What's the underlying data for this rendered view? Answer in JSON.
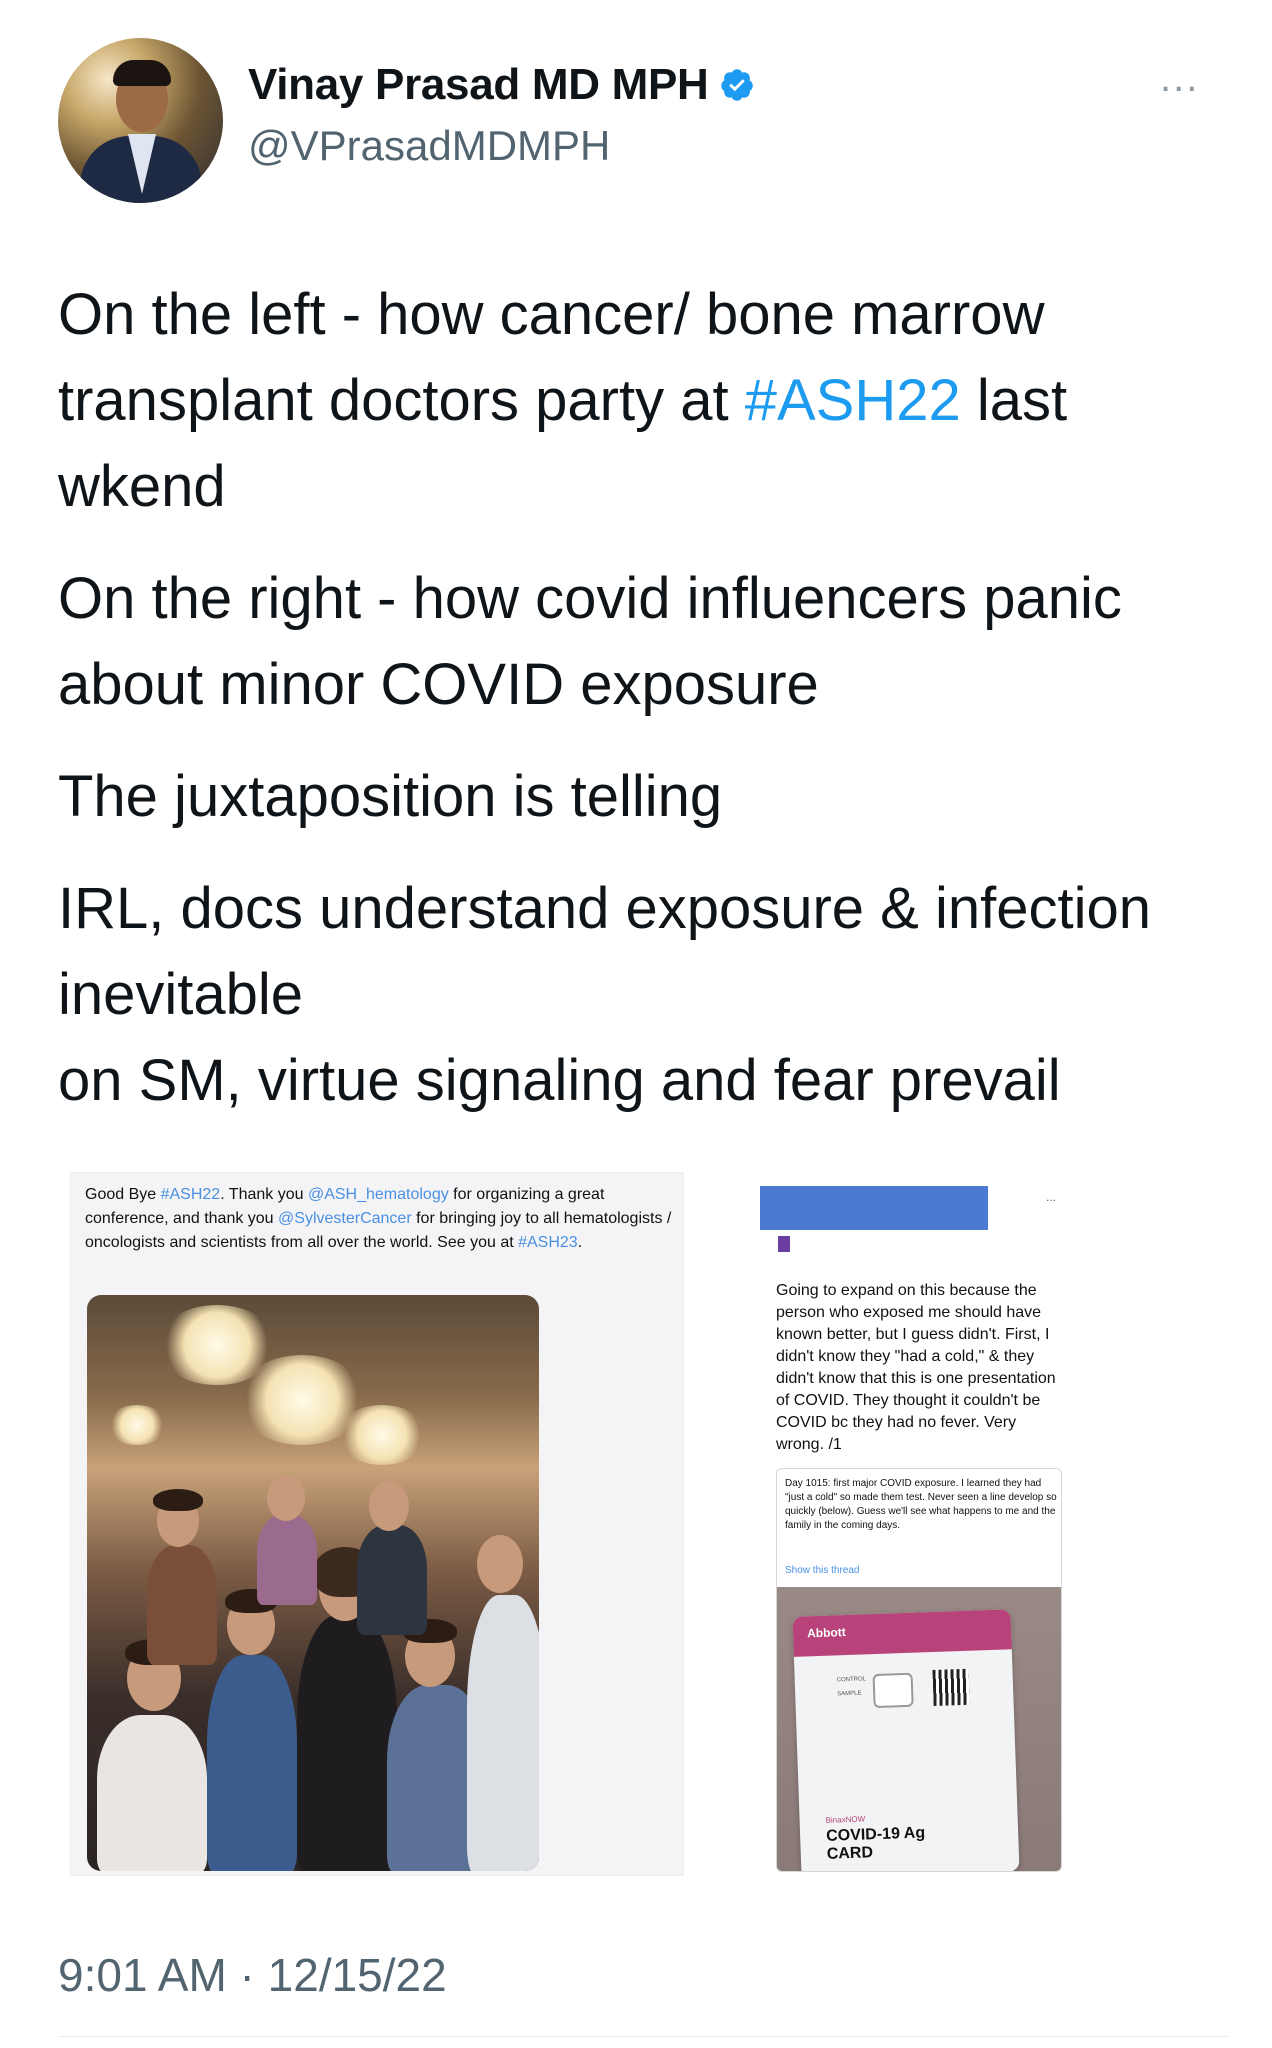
{
  "author": {
    "name": "Vinay Prasad MD MPH",
    "handle": "@VPrasadMDMPH",
    "verified_icon": "verified-badge-icon",
    "more_label": "..."
  },
  "tweet": {
    "p1_pre": "On the left - how cancer/ bone marrow transplant doctors party at ",
    "p1_hashtag": "#ASH22",
    "p1_post": " last wkend",
    "p2": "On the right - how covid influencers panic about minor COVID exposure",
    "p3": "The juxtaposition is telling",
    "p4_line1": "IRL, docs understand exposure & infection inevitable",
    "p4_line2": "on SM, virtue signaling and fear prevail"
  },
  "media_left": {
    "t1": "Good Bye ",
    "tag1": "#ASH22",
    "t2": ". Thank you ",
    "mention1": "@ASH_hematology",
    "t3": " for organizing a great conference, and thank you ",
    "mention2": "@SylvesterCancer",
    "t4": " for bringing joy to all hematologists / oncologists and scientists from all over the world. See you at ",
    "tag2": "#ASH23",
    "t5": "."
  },
  "media_right": {
    "dots": "...",
    "text": "Going to expand on this because the person who exposed me should have known better, but I guess didn't. First, I didn't know they \"had a cold,\" & they didn't know that this is one presentation of COVID. They thought it couldn't be COVID bc they had no fever. Very wrong. /1",
    "quote_text": "Day 1015: first major COVID exposure. I learned they had \"just a cold\" so made them test. Never seen a line develop so quickly (below). Guess we'll see what happens to me and the family in the coming days.",
    "show_thread": "Show this thread",
    "card_brand": "Abbott",
    "card_control": "CONTROL",
    "card_sample": "SAMPLE",
    "card_binax": "BinaxNOW",
    "card_name": "COVID-19 Ag CARD"
  },
  "footer": {
    "timestamp": "9:01 AM · 12/15/22"
  }
}
